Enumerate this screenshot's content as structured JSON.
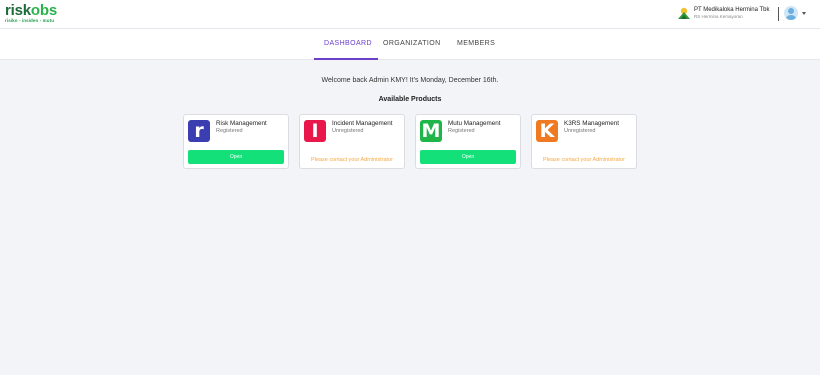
{
  "brand": {
    "name_part1": "risk",
    "name_part2": "obs",
    "tagline": "risiko - insiden - mutu"
  },
  "org": {
    "name": "PT Medikaloka Hermina Tbk",
    "unit": "RS Hermina Kemayoran",
    "logo_icon": "hermina-logo-icon"
  },
  "user": {
    "avatar_icon": "user-avatar-icon"
  },
  "nav": {
    "tabs": [
      {
        "label": "DASHBOARD",
        "active": true
      },
      {
        "label": "ORGANIZATION",
        "active": false
      },
      {
        "label": "MEMBERS",
        "active": false
      }
    ]
  },
  "main": {
    "welcome": "Welcome back Admin KMY! It's Monday, December 16th.",
    "section_title": "Available Products"
  },
  "products": [
    {
      "name": "Risk Management",
      "status": "Registered",
      "icon_letter": "r",
      "icon_color": "#3a3eb0",
      "action": "Open"
    },
    {
      "name": "Incident Management",
      "status": "Unregistered",
      "icon_letter": "I",
      "icon_color": "#e8194a",
      "action": "Please contact your Administrator"
    },
    {
      "name": "Mutu Management",
      "status": "Registered",
      "icon_letter": "M",
      "icon_color": "#1fb548",
      "action": "Open"
    },
    {
      "name": "K3RS Management",
      "status": "Unregistered",
      "icon_letter": "K",
      "icon_color": "#f07a22",
      "action": "Please contact your Administrator"
    }
  ],
  "colors": {
    "accent": "#6c3fc9",
    "open_button": "#14e07a",
    "contact_text": "#f5a742",
    "background": "#f3f4f8"
  }
}
